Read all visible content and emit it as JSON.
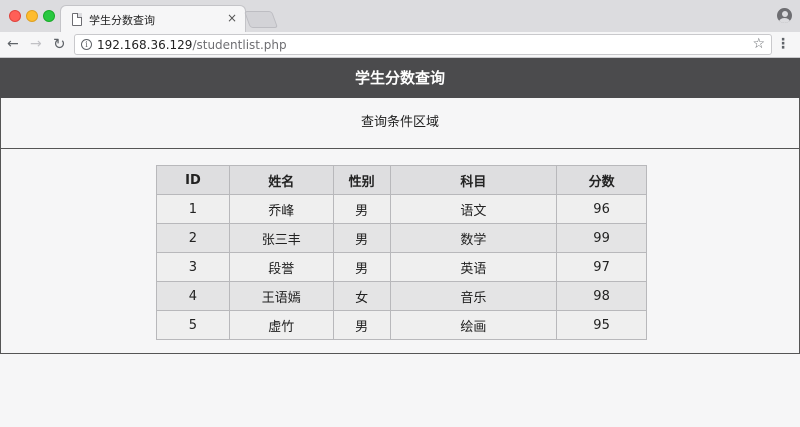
{
  "browser": {
    "tab_title": "学生分数查询",
    "tab_close": "×",
    "url_host": "192.168.36.129",
    "url_path": "/studentlist.php",
    "icons": {
      "back": "arrow-left-icon",
      "forward": "arrow-right-icon",
      "reload": "reload-icon",
      "info": "info-icon",
      "bookmark": "star-icon",
      "menu": "more-vertical-icon",
      "profile": "profile-icon"
    }
  },
  "page": {
    "title": "学生分数查询",
    "query_area": "查询条件区域"
  },
  "table": {
    "headers": [
      "ID",
      "姓名",
      "性别",
      "科目",
      "分数"
    ],
    "rows": [
      [
        "1",
        "乔峰",
        "男",
        "语文",
        "96"
      ],
      [
        "2",
        "张三丰",
        "男",
        "数学",
        "99"
      ],
      [
        "3",
        "段誉",
        "男",
        "英语",
        "97"
      ],
      [
        "4",
        "王语嫣",
        "女",
        "音乐",
        "98"
      ],
      [
        "5",
        "虚竹",
        "男",
        "绘画",
        "95"
      ]
    ]
  },
  "colors": {
    "header_bg": "#4b4b4d",
    "table_header_bg": "#dedee0"
  }
}
